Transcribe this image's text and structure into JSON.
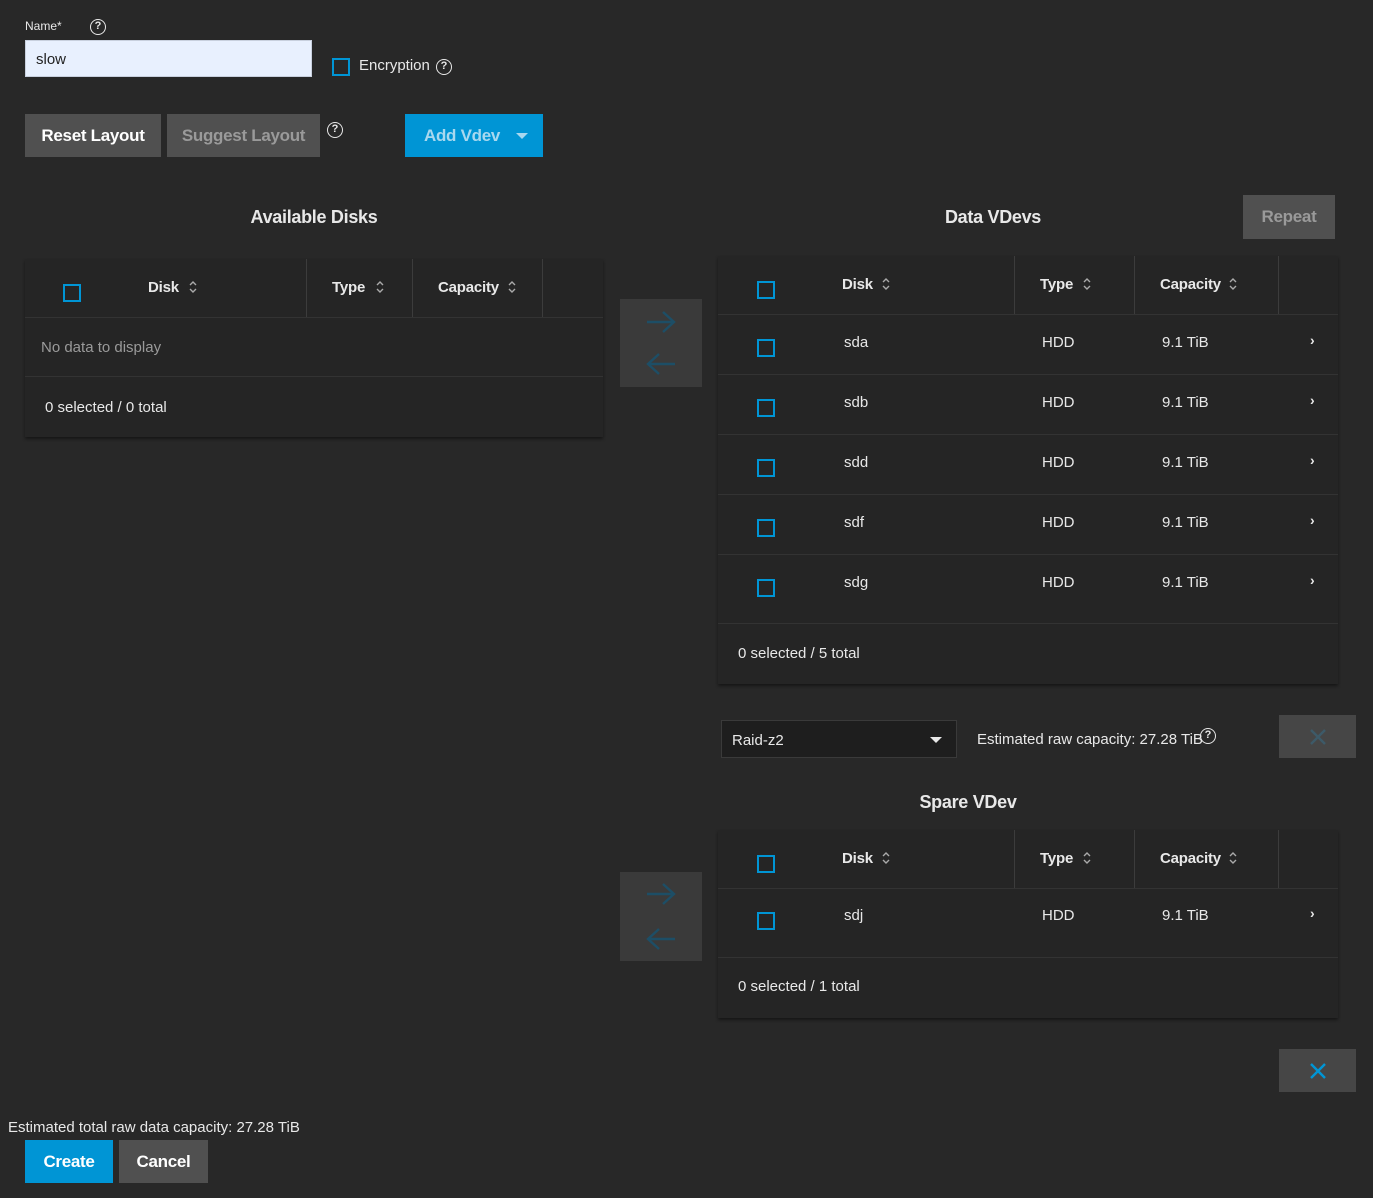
{
  "form": {
    "name_label": "Name*",
    "name_value": "slow",
    "encryption_label": "Encryption"
  },
  "toolbar": {
    "reset_layout": "Reset Layout",
    "suggest_layout": "Suggest Layout",
    "add_vdev": "Add Vdev"
  },
  "available": {
    "title": "Available Disks",
    "headers": {
      "disk": "Disk",
      "type": "Type",
      "capacity": "Capacity"
    },
    "empty": "No data to display",
    "footer": "0 selected / 0 total"
  },
  "data_vdevs": {
    "title": "Data VDevs",
    "repeat": "Repeat",
    "headers": {
      "disk": "Disk",
      "type": "Type",
      "capacity": "Capacity"
    },
    "rows": [
      {
        "disk": "sda",
        "type": "HDD",
        "capacity": "9.1 TiB"
      },
      {
        "disk": "sdb",
        "type": "HDD",
        "capacity": "9.1 TiB"
      },
      {
        "disk": "sdd",
        "type": "HDD",
        "capacity": "9.1 TiB"
      },
      {
        "disk": "sdf",
        "type": "HDD",
        "capacity": "9.1 TiB"
      },
      {
        "disk": "sdg",
        "type": "HDD",
        "capacity": "9.1 TiB"
      }
    ],
    "footer": "0 selected / 5 total",
    "layout_select": "Raid-z2",
    "estimated": "Estimated raw capacity: 27.28 TiB"
  },
  "spare_vdev": {
    "title": "Spare VDev",
    "headers": {
      "disk": "Disk",
      "type": "Type",
      "capacity": "Capacity"
    },
    "rows": [
      {
        "disk": "sdj",
        "type": "HDD",
        "capacity": "9.1 TiB"
      }
    ],
    "footer": "0 selected / 1 total"
  },
  "bottom": {
    "total_estimate": "Estimated total raw data capacity: 27.28 TiB",
    "create": "Create",
    "cancel": "Cancel"
  },
  "colors": {
    "background": "#282828",
    "accent": "#0095d5",
    "button_grey": "#505050"
  }
}
